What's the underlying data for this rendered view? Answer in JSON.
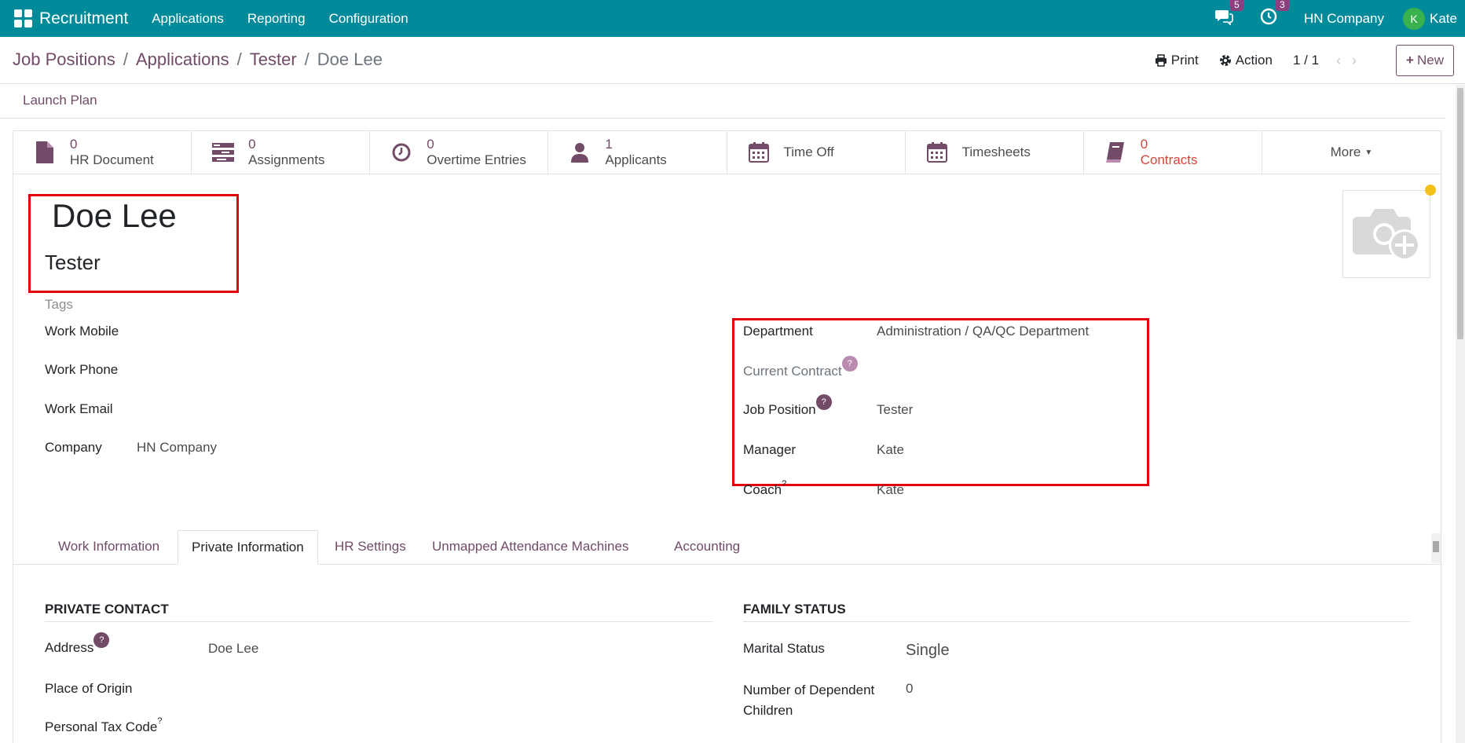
{
  "navbar": {
    "app_name": "Recruitment",
    "menu": [
      "Applications",
      "Reporting",
      "Configuration"
    ],
    "messages_count": "5",
    "activities_count": "3",
    "company": "HN Company",
    "user_initial": "K",
    "user_name": "Kate",
    "bg_color": "#018a99"
  },
  "breadcrumb": {
    "items": [
      "Job Positions",
      "Applications",
      "Tester"
    ],
    "separator": "/",
    "current": "Doe Lee"
  },
  "control": {
    "print_label": "Print",
    "action_label": "Action",
    "pager": "1 / 1",
    "new_label": "New"
  },
  "statusbar": {
    "launch_plan": "Launch Plan"
  },
  "smart_buttons": [
    {
      "count": "0",
      "label": "HR Document",
      "icon": "file-icon"
    },
    {
      "count": "0",
      "label": "Assignments",
      "icon": "tasks-icon"
    },
    {
      "count": "0",
      "label": "Overtime Entries",
      "icon": "clock-icon"
    },
    {
      "count": "1",
      "label": "Applicants",
      "icon": "user-icon"
    },
    {
      "label": "Time Off",
      "icon": "calendar-icon"
    },
    {
      "label": "Timesheets",
      "icon": "calendar-icon"
    },
    {
      "count": "0",
      "label": "Contracts",
      "icon": "book-icon"
    },
    {
      "label": "More"
    }
  ],
  "employee": {
    "name": "Doe Lee",
    "job_title": "Tester",
    "tags_placeholder": "Tags"
  },
  "left_fields": {
    "work_mobile_label": "Work Mobile",
    "work_phone_label": "Work Phone",
    "work_email_label": "Work Email",
    "company_label": "Company",
    "company_value": "HN Company"
  },
  "right_fields": {
    "department_label": "Department",
    "department_value": "Administration / QA/QC Department",
    "current_contract_label": "Current Contract",
    "job_position_label": "Job Position",
    "job_position_value": "Tester",
    "manager_label": "Manager",
    "manager_value": "Kate",
    "coach_label": "Coach",
    "coach_value": "Kate"
  },
  "tabs": [
    "Work Information",
    "Private Information",
    "HR Settings",
    "Unmapped Attendance Machines",
    "Accounting"
  ],
  "active_tab": "Private Information",
  "private_contact": {
    "title": "PRIVATE CONTACT",
    "address_label": "Address",
    "address_value": "Doe Lee",
    "place_of_origin_label": "Place of Origin",
    "personal_tax_code_label": "Personal Tax Code"
  },
  "family_status": {
    "title": "FAMILY STATUS",
    "marital_status_label": "Marital Status",
    "marital_status_value": "Single",
    "dependent_children_label_1": "Number of Dependent",
    "dependent_children_label_2": "Children",
    "dependent_children_value": "0"
  },
  "colors": {
    "accent": "#714b67",
    "highlight_box": "#e3000b",
    "contracts_red": "#d9453c"
  }
}
